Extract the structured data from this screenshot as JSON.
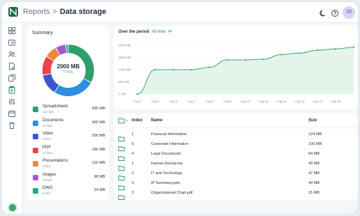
{
  "header": {
    "breadcrumb_parent": "Reports",
    "breadcrumb_sep": ">",
    "breadcrumb_current": "Data storage",
    "avatar_initials": "JD"
  },
  "sidebar": {
    "items": [
      {
        "icon": "dashboard-icon"
      },
      {
        "icon": "folder-icon"
      },
      {
        "icon": "users-icon"
      },
      {
        "icon": "document-icon"
      },
      {
        "icon": "files-icon"
      },
      {
        "icon": "clipboard-icon",
        "active": true
      },
      {
        "icon": "sliders-icon"
      },
      {
        "icon": "calendar-icon"
      },
      {
        "icon": "trash-icon"
      }
    ]
  },
  "summary": {
    "title": "Summary",
    "total_value": "2000 MB",
    "total_label": "TOTAL",
    "items": [
      {
        "name": "Spreadsheets",
        "count": "122 files",
        "size": "500 MB",
        "color": "#2f9e6a",
        "mb": 500
      },
      {
        "name": "Documents",
        "count": "47 files",
        "size": "400 MB",
        "color": "#2d8fe0",
        "mb": 400
      },
      {
        "name": "Video",
        "count": "5 files",
        "size": "200 MB",
        "color": "#3b55d4",
        "mb": 200
      },
      {
        "name": "PDF",
        "count": "47 files",
        "size": "186 MB",
        "color": "#e8454b",
        "mb": 186
      },
      {
        "name": "Presentations",
        "count": "9 files",
        "size": "120 MB",
        "color": "#f0873a",
        "mb": 120
      },
      {
        "name": "Images",
        "count": "20 files",
        "size": "98 MB",
        "color": "#a855d8",
        "mb": 98
      },
      {
        "name": "DWG",
        "count": "8 files",
        "size": "24 MB",
        "color": "#1fa58f",
        "mb": 24
      }
    ]
  },
  "chart_data": {
    "type": "area",
    "period_label": "Over the period",
    "period_value": "All time",
    "x": [
      "Aug 4",
      "Aug 5",
      "Aug 6",
      "Aug 7",
      "Aug 8",
      "Aug 9",
      "Aug 10",
      "Aug 11",
      "Aug 12",
      "Aug 13",
      "Aug 14",
      "Aug 15"
    ],
    "y_ticks": [
      "0 MB",
      "500 MB",
      "1000 MB",
      "1500 MB",
      "2000 MB"
    ],
    "ylim": [
      0,
      2000
    ],
    "values": [
      0,
      1000,
      1000,
      1000,
      1100,
      1400,
      1400,
      1430,
      1620,
      1680,
      1800,
      1850,
      1920
    ],
    "x_positions": [
      0,
      1,
      2,
      3,
      4,
      5,
      6,
      7,
      8,
      9,
      10,
      11,
      12
    ],
    "color": "#3aa66d"
  },
  "table": {
    "headers": {
      "index": "Index",
      "name": "Name",
      "size": "Size"
    },
    "rows": [
      {
        "index": "1",
        "name": "Financial Information",
        "size": "124 MB"
      },
      {
        "index": "5",
        "name": "Corporate Information",
        "size": "100 MB"
      },
      {
        "index": "4",
        "name": "Legal Documents",
        "size": "84 MB"
      },
      {
        "index": "1",
        "name": "Human Resources",
        "size": "49 MB"
      },
      {
        "index": "2",
        "name": "IT and Technology",
        "size": "47 MB"
      },
      {
        "index": "3",
        "name": "IP Summary.pptx",
        "size": "40 MB"
      },
      {
        "index": "2",
        "name": "Organizational Chart.pdf",
        "size": "15 MB"
      }
    ]
  }
}
